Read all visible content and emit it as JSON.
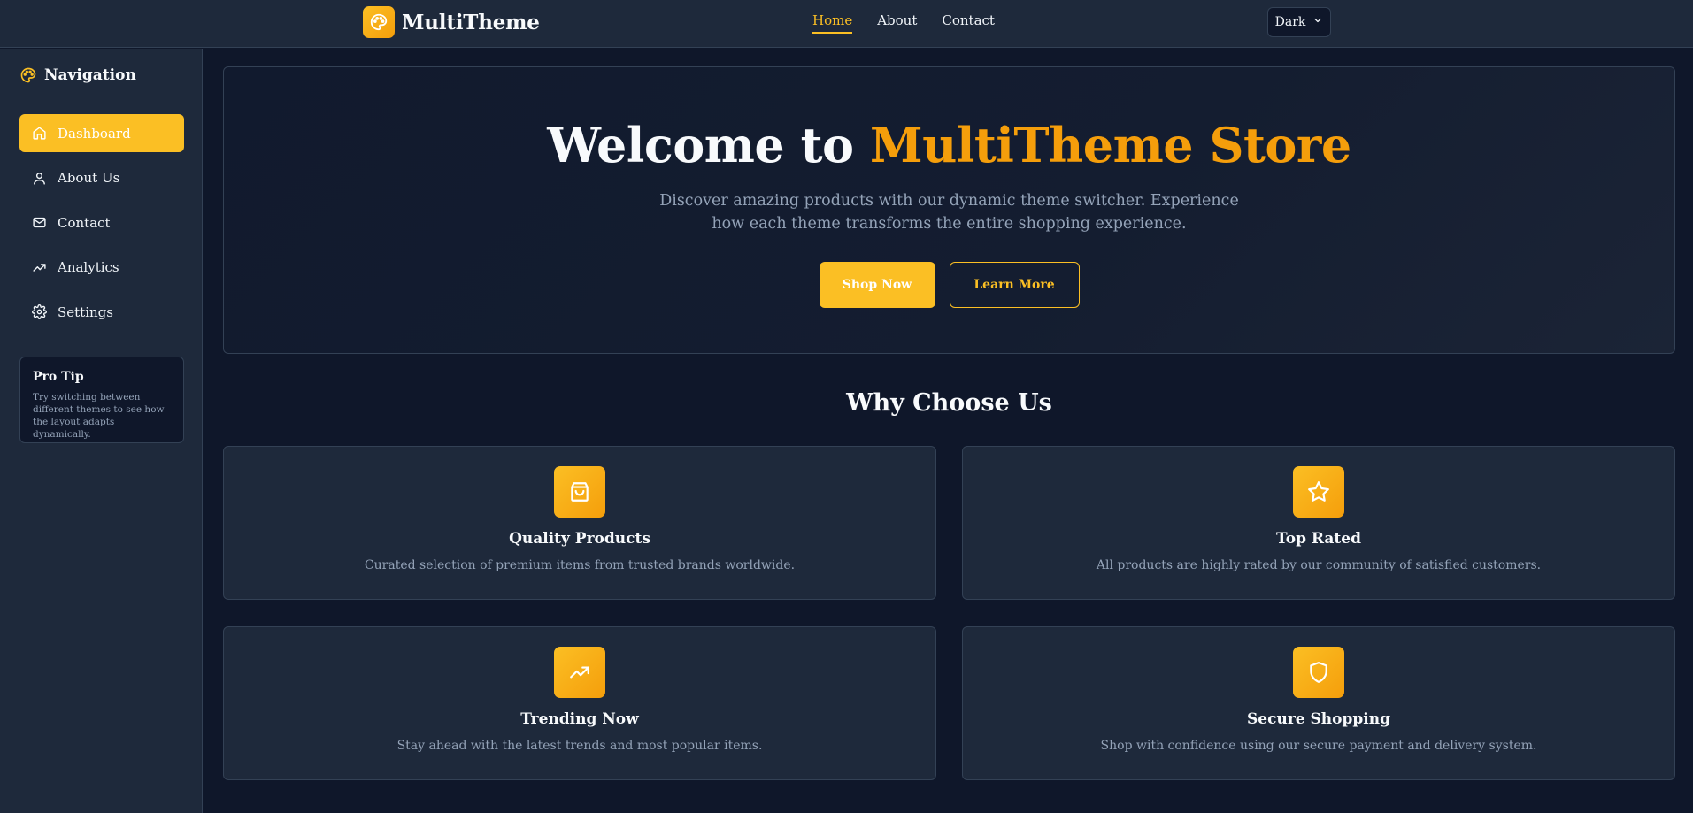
{
  "header": {
    "brand": "MultiTheme",
    "nav": [
      "Home",
      "About",
      "Contact"
    ],
    "active_nav": "Home",
    "theme_select": "Dark"
  },
  "sidebar": {
    "title": "Navigation",
    "items": [
      {
        "label": "Dashboard",
        "icon": "home-icon",
        "active": true
      },
      {
        "label": "About Us",
        "icon": "user-icon",
        "active": false
      },
      {
        "label": "Contact",
        "icon": "mail-icon",
        "active": false
      },
      {
        "label": "Analytics",
        "icon": "trending-up-icon",
        "active": false
      },
      {
        "label": "Settings",
        "icon": "gear-icon",
        "active": false
      }
    ],
    "tip": {
      "title": "Pro Tip",
      "text": "Try switching between different themes to see how the layout adapts dynamically."
    }
  },
  "hero": {
    "title_prefix": "Welcome to ",
    "title_accent": "MultiTheme Store",
    "subtitle": "Discover amazing products with our dynamic theme switcher. Experience how each theme transforms the entire shopping experience.",
    "primary_button": "Shop Now",
    "secondary_button": "Learn More"
  },
  "features": {
    "title": "Why Choose Us",
    "cards": [
      {
        "title": "Quality Products",
        "text": "Curated selection of premium items from trusted brands worldwide.",
        "icon": "shopping-bag-icon"
      },
      {
        "title": "Top Rated",
        "text": "All products are highly rated by our community of satisfied customers.",
        "icon": "star-icon"
      },
      {
        "title": "Trending Now",
        "text": "Stay ahead with the latest trends and most popular items.",
        "icon": "trending-up-icon"
      },
      {
        "title": "Secure Shopping",
        "text": "Shop with confidence using our secure payment and delivery system.",
        "icon": "shield-icon"
      }
    ]
  },
  "colors": {
    "background": "#0f172a",
    "surface": "#1e293b",
    "border": "#334155",
    "accent": "#fbbf24",
    "accent_dark": "#f59e0b",
    "text_muted": "#94a3b8"
  }
}
